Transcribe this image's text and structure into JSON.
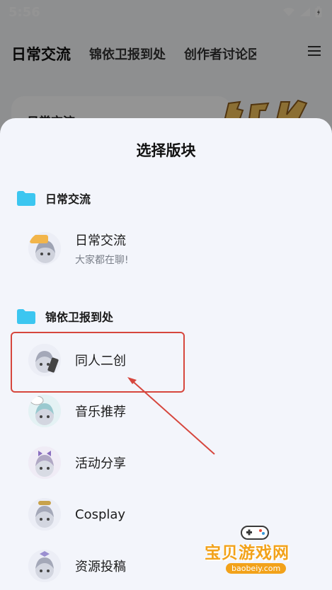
{
  "status_bar": {
    "time": "5:56"
  },
  "top_tabs": [
    "日常交流",
    "锦依卫报到处",
    "创作者讨论区"
  ],
  "banner": {
    "title": "日常交流"
  },
  "sheet": {
    "title": "选择版块",
    "groups": [
      {
        "title": "日常交流",
        "items": [
          {
            "name": "日常交流",
            "subtitle": "大家都在聊!"
          }
        ]
      },
      {
        "title": "锦依卫报到处",
        "items": [
          {
            "name": "同人二创"
          },
          {
            "name": "音乐推荐"
          },
          {
            "name": "活动分享"
          },
          {
            "name": "Cosplay"
          },
          {
            "name": "资源投稿"
          }
        ]
      }
    ]
  },
  "watermark": {
    "text": "宝贝游戏网",
    "url": "baobeiy.com"
  },
  "colors": {
    "folder": "#3cc6f0",
    "highlight": "#d6463d",
    "tab_accent": "#58d0f0",
    "watermark": "#f2a21a"
  }
}
